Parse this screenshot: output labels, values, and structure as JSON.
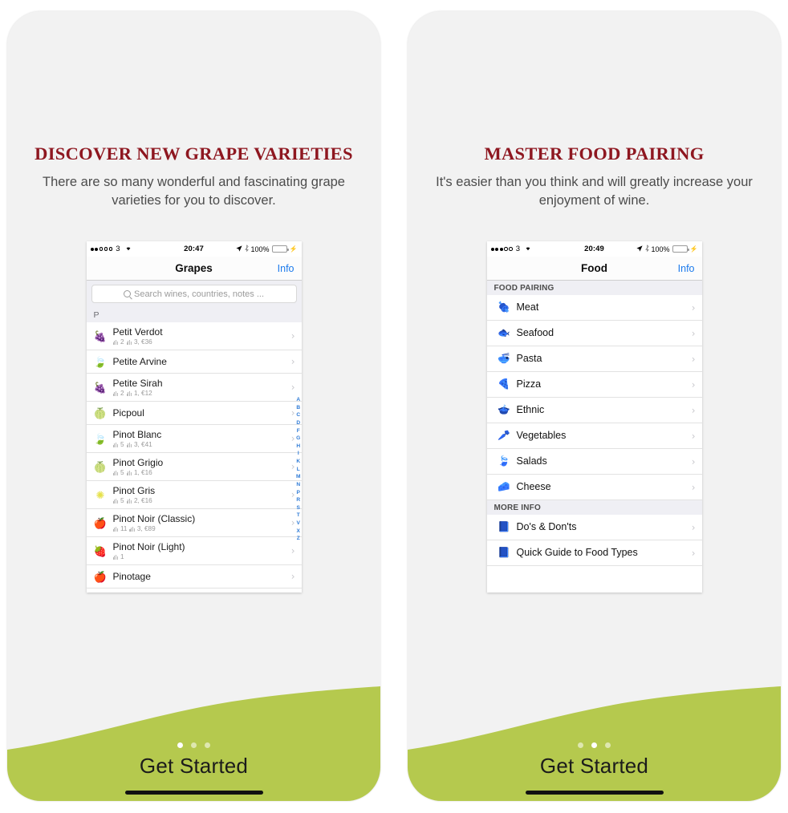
{
  "theme": {
    "accent_red": "#8e1720",
    "green_wave": "#b5c94e",
    "ios_blue": "#1b7aec",
    "panel_bg": "#f2f2f2"
  },
  "panels": [
    {
      "headline": "DISCOVER NEW GRAPE VARIETIES",
      "subtitle": "There are so many wonderful and fascinating grape varieties for you to discover.",
      "cta": "Get Started",
      "active_dot": 0,
      "dots_count": 3,
      "phone": {
        "status": {
          "signal_dots_filled": 2,
          "signal_dots_total": 5,
          "carrier": "3",
          "wifi_icon": "wifi-icon",
          "time": "20:47",
          "location_icon": "location-arrow-icon",
          "bluetooth_icon": "bluetooth-icon",
          "battery_text": "100%",
          "battery_level": 100
        },
        "nav": {
          "title": "Grapes",
          "right_action": "Info"
        },
        "search": {
          "placeholder": "Search wines, countries, notes ...",
          "icon": "search-icon"
        },
        "section_header": "P",
        "index_letters": [
          "A",
          "B",
          "C",
          "D",
          "F",
          "G",
          "H",
          "I",
          "K",
          "L",
          "M",
          "N",
          "P",
          "R",
          "S",
          "T",
          "V",
          "X",
          "Z"
        ],
        "rows": [
          {
            "icon": "🍇",
            "icon_name": "dark-grape-icon",
            "color": "#c4312c",
            "name": "Petit Verdot",
            "sub_a": "2",
            "sub_b": "3, €36"
          },
          {
            "icon": "🍃",
            "icon_name": "green-leaf-icon",
            "color": "#8dc63f",
            "name": "Petite Arvine",
            "sub_a": "",
            "sub_b": ""
          },
          {
            "icon": "🍇",
            "icon_name": "dark-grape-icon",
            "color": "#c4312c",
            "name": "Petite Sirah",
            "sub_a": "2",
            "sub_b": "1, €12"
          },
          {
            "icon": "🍈",
            "icon_name": "green-grape-icon",
            "color": "#b5d34a",
            "name": "Picpoul",
            "sub_a": "",
            "sub_b": ""
          },
          {
            "icon": "🍃",
            "icon_name": "green-leaf-icon",
            "color": "#8dc63f",
            "name": "Pinot Blanc",
            "sub_a": "5",
            "sub_b": "3, €41"
          },
          {
            "icon": "🍈",
            "icon_name": "green-grape-icon",
            "color": "#b5d34a",
            "name": "Pinot Grigio",
            "sub_a": "5",
            "sub_b": "1, €16"
          },
          {
            "icon": "✺",
            "icon_name": "yellow-flower-icon",
            "color": "#e6e14a",
            "name": "Pinot Gris",
            "sub_a": "5",
            "sub_b": "2, €16"
          },
          {
            "icon": "🍎",
            "icon_name": "red-fruit-icon",
            "color": "#c0241f",
            "name": "Pinot Noir (Classic)",
            "sub_a": "11",
            "sub_b": "3, €89"
          },
          {
            "icon": "🍓",
            "icon_name": "light-red-fruit-icon",
            "color": "#d4524a",
            "name": "Pinot Noir (Light)",
            "sub_a": "1",
            "sub_b": ""
          },
          {
            "icon": "🍎",
            "icon_name": "red-fruit-icon",
            "color": "#c0241f",
            "name": "Pinotage",
            "sub_a": "",
            "sub_b": ""
          }
        ]
      }
    },
    {
      "headline": "MASTER FOOD PAIRING",
      "subtitle": "It's easier than you think and will greatly increase your enjoyment of wine.",
      "cta": "Get Started",
      "active_dot": 1,
      "dots_count": 3,
      "phone": {
        "status": {
          "signal_dots_filled": 3,
          "signal_dots_total": 5,
          "carrier": "3",
          "wifi_icon": "wifi-icon",
          "time": "20:49",
          "location_icon": "location-arrow-icon",
          "bluetooth_icon": "bluetooth-icon",
          "battery_text": "100%",
          "battery_level": 100
        },
        "nav": {
          "title": "Food",
          "right_action": "Info"
        },
        "sections": [
          {
            "header": "FOOD PAIRING",
            "rows": [
              {
                "icon": "🍖",
                "icon_name": "meat-icon",
                "name": "Meat"
              },
              {
                "icon": "🐟",
                "icon_name": "fish-icon",
                "name": "Seafood"
              },
              {
                "icon": "🍜",
                "icon_name": "pasta-bowl-icon",
                "name": "Pasta"
              },
              {
                "icon": "🍕",
                "icon_name": "pizza-slice-icon",
                "name": "Pizza"
              },
              {
                "icon": "🍲",
                "icon_name": "bowl-icon",
                "name": "Ethnic"
              },
              {
                "icon": "🥕",
                "icon_name": "carrot-icon",
                "name": "Vegetables"
              },
              {
                "icon": "🍃",
                "icon_name": "leaf-icon",
                "name": "Salads"
              },
              {
                "icon": "🧀",
                "icon_name": "cheese-wedge-icon",
                "name": "Cheese"
              }
            ]
          },
          {
            "header": "MORE INFO",
            "rows": [
              {
                "icon": "📘",
                "icon_name": "book-icon",
                "name": "Do's & Don'ts"
              },
              {
                "icon": "📘",
                "icon_name": "book-icon",
                "name": "Quick Guide to Food Types"
              }
            ]
          }
        ]
      }
    }
  ]
}
